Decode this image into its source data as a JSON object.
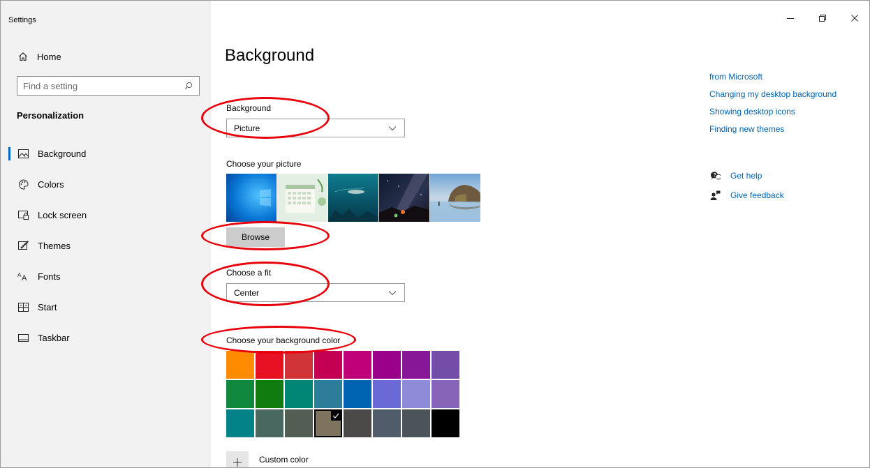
{
  "window": {
    "app_title": "Settings"
  },
  "sidebar": {
    "home_label": "Home",
    "search_placeholder": "Find a setting",
    "section_title": "Personalization",
    "items": [
      {
        "label": "Background",
        "icon": "picture-icon",
        "active": true
      },
      {
        "label": "Colors",
        "icon": "palette-icon",
        "active": false
      },
      {
        "label": "Lock screen",
        "icon": "lock-screen-icon",
        "active": false
      },
      {
        "label": "Themes",
        "icon": "brush-icon",
        "active": false
      },
      {
        "label": "Fonts",
        "icon": "fonts-icon",
        "active": false
      },
      {
        "label": "Start",
        "icon": "start-icon",
        "active": false
      },
      {
        "label": "Taskbar",
        "icon": "taskbar-icon",
        "active": false
      }
    ]
  },
  "main": {
    "page_title": "Background",
    "background_label": "Background",
    "background_value": "Picture",
    "choose_picture_label": "Choose your picture",
    "browse_label": "Browse",
    "fit_label": "Choose a fit",
    "fit_value": "Center",
    "color_label": "Choose your background color",
    "custom_color_label": "Custom color",
    "colors": [
      "#ff8c00",
      "#e81123",
      "#d13438",
      "#c30052",
      "#bf0077",
      "#9a0089",
      "#881798",
      "#744da9",
      "#10893e",
      "#107c10",
      "#018574",
      "#2d7d9a",
      "#0063b1",
      "#6b69d6",
      "#8e8cd8",
      "#8764b8",
      "#038387",
      "#486860",
      "#525e54",
      "#7e735f",
      "#4c4a48",
      "#515c6b",
      "#4a5459",
      "#000000"
    ],
    "selected_color_index": 19
  },
  "related_links": [
    "from Microsoft",
    "Changing my desktop background",
    "Showing desktop icons",
    "Finding new themes"
  ],
  "help": {
    "get_help": "Get help",
    "give_feedback": "Give feedback"
  },
  "theme": {
    "accent": "#0067c0",
    "link": "#0063b1",
    "sidebar_bg": "#f2f2f2",
    "annotation": "#e8000b"
  }
}
